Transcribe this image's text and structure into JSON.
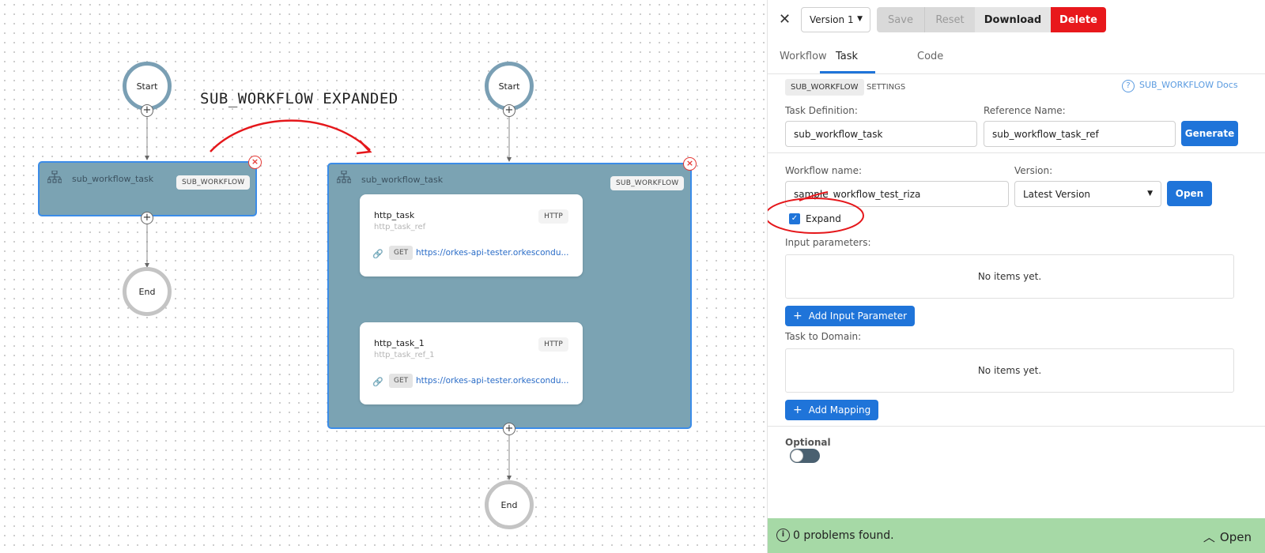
{
  "canvas": {
    "annotation_title": "SUB_WORKFLOW EXPANDED",
    "collapsed": {
      "start_label": "Start",
      "end_label": "End",
      "task_title": "sub_workflow_task",
      "task_badge": "SUB_WORKFLOW"
    },
    "expanded": {
      "start_label": "Start",
      "end_label": "End",
      "task_title": "sub_workflow_task",
      "task_badge": "SUB_WORKFLOW",
      "tasks": [
        {
          "name": "http_task",
          "ref": "http_task_ref",
          "badge": "HTTP",
          "method": "GET",
          "url": "https://orkes-api-tester.orkescondu..."
        },
        {
          "name": "http_task_1",
          "ref": "http_task_ref_1",
          "badge": "HTTP",
          "method": "GET",
          "url": "https://orkes-api-tester.orkescondu..."
        }
      ]
    },
    "colors": {
      "annotation_red": "#e5171b",
      "node_fill": "#7ba3b3",
      "node_border": "#3b8ce8"
    }
  },
  "panel": {
    "toolbar": {
      "version_value": "Version 1",
      "save_label": "Save",
      "reset_label": "Reset",
      "download_label": "Download",
      "delete_label": "Delete"
    },
    "tabs": [
      "Workflow",
      "Task",
      "Code"
    ],
    "active_tab": "Task",
    "section": {
      "type_tag": "SUB_WORKFLOW",
      "settings_label": "SETTINGS",
      "docs_link": "SUB_WORKFLOW Docs"
    },
    "task_definition": {
      "label": "Task Definition:",
      "value": "sub_workflow_task"
    },
    "reference_name": {
      "label": "Reference Name:",
      "value": "sub_workflow_task_ref"
    },
    "generate_label": "Generate",
    "workflow_name": {
      "label": "Workflow name:",
      "value": "sample_workflow_test_riza"
    },
    "version": {
      "label": "Version:",
      "value": "Latest Version"
    },
    "open_label": "Open",
    "expand": {
      "label": "Expand",
      "checked": true
    },
    "input_parameters": {
      "label": "Input parameters:",
      "empty_text": "No items yet.",
      "add_label": "Add Input Parameter"
    },
    "task_to_domain": {
      "label": "Task to Domain:",
      "empty_text": "No items yet.",
      "add_label": "Add Mapping"
    },
    "optional": {
      "label": "Optional",
      "enabled": false
    },
    "status": {
      "text": "0 problems found.",
      "open_label": "Open",
      "color": "#a6d9a6"
    }
  }
}
